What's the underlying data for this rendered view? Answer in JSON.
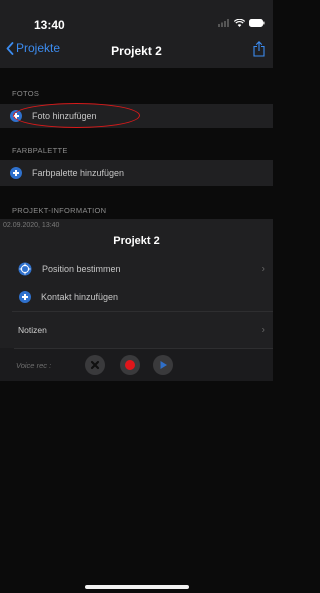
{
  "status_bar": {
    "time": "13:40"
  },
  "nav": {
    "back_label": "Projekte",
    "title": "Projekt 2"
  },
  "sections": {
    "fotos": {
      "label": "FOTOS",
      "action": "Foto hinzufügen"
    },
    "farbpalette": {
      "label": "FARBPALETTE",
      "action": "Farbpalette hinzufügen"
    },
    "info": {
      "label": "PROJEKT-INFORMATION",
      "date": "02.09.2020, 13:40",
      "project_name": "Projekt 2",
      "position_label": "Position bestimmen",
      "contact_label": "Kontakt hinzufügen",
      "notes_label": "Notizen",
      "voice_label": "Voice rec :"
    }
  },
  "colors": {
    "accent": "#3c8cf0",
    "highlight": "#d61a1a",
    "record": "#e0161b"
  },
  "icons": [
    "chevron-left-icon",
    "share-icon",
    "plus-circle-icon",
    "crosshair-icon",
    "chevron-right-icon",
    "delete-icon",
    "record-icon",
    "play-icon"
  ]
}
